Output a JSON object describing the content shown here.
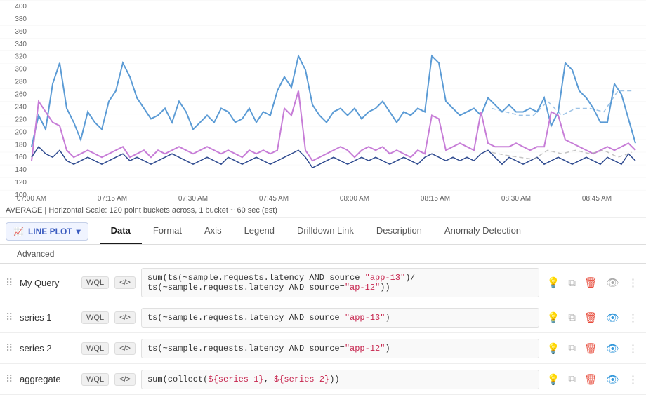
{
  "chart": {
    "y_labels": [
      "400",
      "380",
      "360",
      "340",
      "320",
      "300",
      "280",
      "260",
      "240",
      "220",
      "200",
      "180",
      "160",
      "140",
      "120",
      "100"
    ],
    "x_labels": [
      "07:00 AM",
      "07:15 AM",
      "07:30 AM",
      "07:45 AM",
      "08:00 AM",
      "08:15 AM",
      "08:30 AM",
      "08:45 AM"
    ]
  },
  "avg_label": "AVERAGE  |  Horizontal Scale: 120 point buckets across, 1 bucket ~ 60 sec (est)",
  "chart_type_btn": "LINE PLOT",
  "tabs": [
    {
      "label": "Data",
      "active": true
    },
    {
      "label": "Format",
      "active": false
    },
    {
      "label": "Axis",
      "active": false
    },
    {
      "label": "Legend",
      "active": false
    },
    {
      "label": "Drilldown Link",
      "active": false
    },
    {
      "label": "Description",
      "active": false
    },
    {
      "label": "Anomaly Detection",
      "active": false
    }
  ],
  "secondary_tabs": [
    {
      "label": "Advanced",
      "active": false
    }
  ],
  "rows": [
    {
      "name": "My Query",
      "badge_wql": "WQL",
      "badge_code": "</>",
      "query": "sum(ts(~sample.requests.latency AND source=\"app-13\")/ ts(~sample.requests.latency AND source=\"ap-12\"))"
    },
    {
      "name": "series 1",
      "badge_wql": "WQL",
      "badge_code": "</>",
      "query": "ts(~sample.requests.latency AND source=\"app-13\")"
    },
    {
      "name": "series 2",
      "badge_wql": "WQL",
      "badge_code": "</>",
      "query": "ts(~sample.requests.latency AND source=\"app-12\")"
    },
    {
      "name": "aggregate",
      "badge_wql": "WQL",
      "badge_code": "</>",
      "query": "sum(collect(${series 1}, ${series 2}))"
    }
  ],
  "icons": {
    "drag": "⠿",
    "lightbulb": "💡",
    "copy": "⧉",
    "trash": "🗑",
    "eye": "👁",
    "more": "⋮"
  }
}
